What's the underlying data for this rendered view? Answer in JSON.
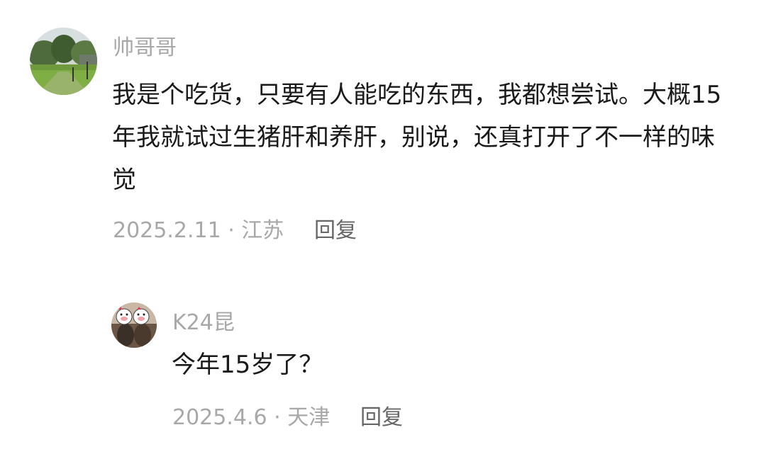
{
  "comments": [
    {
      "username": "帅哥哥",
      "text": "我是个吃货，只要有人能吃的东西，我都想尝试。大概15年我就试过生猪肝和养肝，别说，还真打开了不一样的味觉",
      "meta": "2025.2.11 · 江苏",
      "reply_label": "回复"
    },
    {
      "username": "K24昆",
      "text": "今年15岁了？",
      "meta": "2025.4.6 · 天津",
      "reply_label": "回复"
    }
  ]
}
